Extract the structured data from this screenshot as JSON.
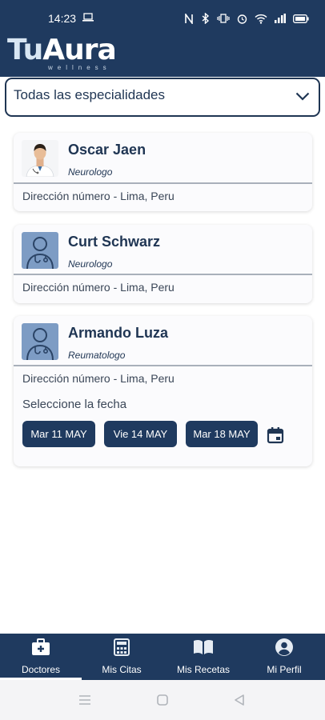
{
  "status_bar": {
    "time": "14:23"
  },
  "header": {
    "logo_tu": "Tu",
    "logo_aura": "Aura",
    "logo_sub": "wellness"
  },
  "filter": {
    "selected": "Todas las especialidades"
  },
  "doctors": [
    {
      "name": "Oscar Jaen",
      "specialty": "Neurologo",
      "address": "Dirección número - Lima, Peru",
      "avatar": "doctor-photo"
    },
    {
      "name": "Curt Schwarz",
      "specialty": "Neurologo",
      "address": "Dirección número - Lima, Peru",
      "avatar": "doctor-placeholder-icon"
    },
    {
      "name": "Armando Luza",
      "specialty": "Reumatologo",
      "address": "Dirección número - Lima, Peru",
      "avatar": "doctor-placeholder-icon",
      "select_date_label": "Seleccione la fecha",
      "dates": [
        "Mar 11 MAY",
        "Vie 14 MAY",
        "Mar 18 MAY"
      ]
    }
  ],
  "bottom_nav": [
    {
      "label": "Doctores",
      "icon": "medical-bag-icon",
      "active": true
    },
    {
      "label": "Mis Citas",
      "icon": "calculator-icon",
      "active": false
    },
    {
      "label": "Mis Recetas",
      "icon": "book-icon",
      "active": false
    },
    {
      "label": "Mi Perfil",
      "icon": "account-circle-icon",
      "active": false
    }
  ],
  "colors": {
    "primary": "#1f3a5f",
    "text": "#1f3553",
    "card_bg": "#fbfbfd"
  }
}
